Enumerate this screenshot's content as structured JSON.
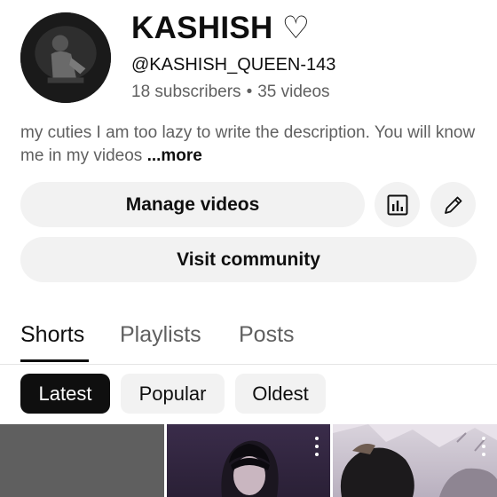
{
  "channel": {
    "name": "KASHISH ♡",
    "handle": "@KASHISH_QUEEN-143",
    "subscribers": "18 subscribers",
    "separator": "•",
    "videos": "35 videos",
    "description": "my cuties I am too lazy to write the description. You will know me in my videos",
    "more_label": "...more"
  },
  "actions": {
    "manage_videos": "Manage videos",
    "analytics_icon": "bar-chart-icon",
    "edit_icon": "pencil-icon",
    "visit_community": "Visit community"
  },
  "tabs": [
    {
      "label": "Shorts",
      "active": true
    },
    {
      "label": "Playlists",
      "active": false
    },
    {
      "label": "Posts",
      "active": false
    }
  ],
  "sort_chips": [
    {
      "label": "Latest",
      "selected": true
    },
    {
      "label": "Popular",
      "selected": false
    },
    {
      "label": "Oldest",
      "selected": false
    }
  ],
  "colors": {
    "text_primary": "#0f0f0f",
    "text_secondary": "#606060",
    "chip_bg": "#f2f2f2",
    "chip_selected_bg": "#0f0f0f"
  }
}
